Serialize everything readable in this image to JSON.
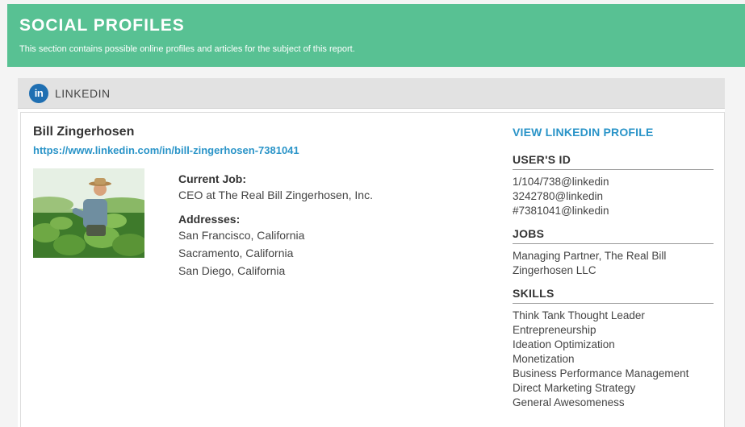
{
  "header": {
    "title": "SOCIAL PROFILES",
    "subtitle": "This section contains possible online profiles and articles for the subject of this report."
  },
  "panel": {
    "icon": "linkedin-icon",
    "icon_text": "in",
    "label": "LINKEDIN"
  },
  "profile": {
    "name": "Bill Zingerhosen",
    "url": "https://www.linkedin.com/in/bill-zingerhosen-7381041",
    "current_job_label": "Current Job:",
    "current_job": "CEO at The Real Bill Zingerhosen, Inc.",
    "addresses_label": "Addresses:",
    "addresses": [
      "San Francisco, California",
      "Sacramento, California",
      "San Diego, California"
    ]
  },
  "sidebar": {
    "view_link": "VIEW LINKEDIN PROFILE",
    "users_id_title": "USER'S ID",
    "user_ids": [
      "1/104/738@linkedin",
      "3242780@linkedin",
      "#7381041@linkedin"
    ],
    "jobs_title": "JOBS",
    "jobs": [
      "Managing Partner, The Real Bill",
      "Zingerhosen LLC"
    ],
    "skills_title": "SKILLS",
    "skills": [
      "Think Tank Thought Leader",
      "Entrepreneurship",
      "Ideation Optimization",
      "Monetization",
      "Business Performance Management",
      "Direct Marketing Strategy",
      "General Awesomeness"
    ]
  },
  "colors": {
    "header_bg": "#58c193",
    "link": "#2a94c8",
    "linkedin_blue": "#1f6fb2"
  }
}
